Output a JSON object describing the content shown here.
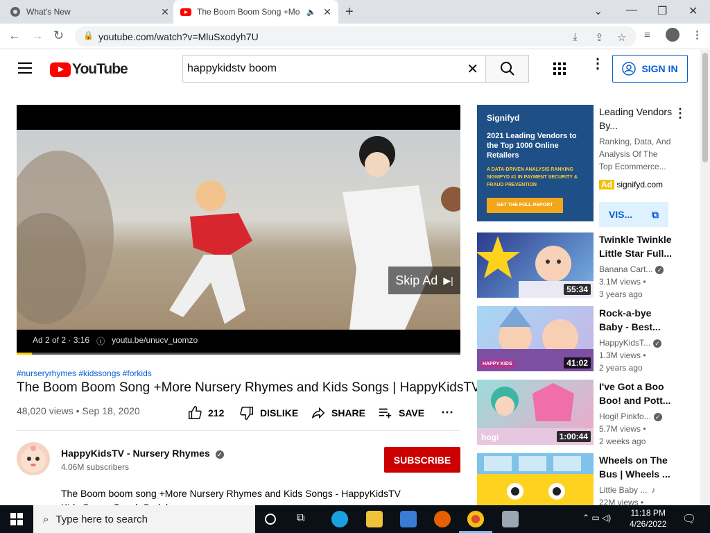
{
  "browser": {
    "tabs": [
      {
        "title": "What's New"
      },
      {
        "title": "The Boom Boom Song +Mo"
      }
    ],
    "url": "youtube.com/watch?v=MluSxodyh7U"
  },
  "header": {
    "logo_text": "YouTube",
    "search_value": "happykidstv boom",
    "signin_label": "SIGN IN"
  },
  "player": {
    "skip_label": "Skip Ad",
    "ad_counter": "Ad 2 of 2 · 3:16",
    "ad_link": "youtu.be/unucv_uomzo",
    "ad_progress_pct": 3.4
  },
  "video": {
    "tags": "#nurseryrhymes #kidssongs #forkids",
    "title": "The Boom Boom Song +More Nursery Rhymes and Kids Songs | HappyKidsTV",
    "stats": "48,020 views • Sep 18, 2020",
    "likes": "212",
    "dislike_label": "DISLIKE",
    "share_label": "SHARE",
    "save_label": "SAVE"
  },
  "channel": {
    "name": "HappyKidsTV - Nursery Rhymes",
    "subscribers": "4.06M subscribers",
    "subscribe_label": "SUBSCRIBE",
    "description_line1": "The Boom boom song +More Nursery Rhymes and Kids Songs - HappyKidsTV",
    "description_line2": "Kids Songs Çocuk Şarkıları"
  },
  "sidebar": {
    "ad": {
      "title": "Leading Vendors By...",
      "desc": "Ranking, Data, And Analysis Of The Top Ecommerce...",
      "badge": "Ad",
      "domain": "signifyd.com",
      "visit_label": "VIS...",
      "thumb_brand": "Signifyd",
      "thumb_headline": "2021 Leading Vendors to the Top 1000 Online Retailers",
      "thumb_sub": "A DATA-DRIVEN ANALYSIS RANKING SIGNIFYD #1 IN PAYMENT SECURITY & FRAUD PREVENTION",
      "thumb_cta": "GET THE FULL REPORT"
    },
    "videos": [
      {
        "title": "Twinkle Twinkle Little Star Full...",
        "channel": "Banana Cart...",
        "views": "3.1M views •",
        "age": "3 years ago",
        "duration": "55:34"
      },
      {
        "title": "Rock-a-bye Baby - Best...",
        "channel": "HappyKidsT...",
        "views": "1.3M views •",
        "age": "2 years ago",
        "duration": "41:02",
        "thumb_badge": "HAPPY KIDS"
      },
      {
        "title": "I've Got a Boo Boo! and Pott...",
        "channel": "Hogi! Pinkfo...",
        "views": "5.7M views •",
        "age": "2 weeks ago",
        "duration": "1:00:44",
        "thumb_badge": "hogi"
      },
      {
        "title": "Wheels on The Bus | Wheels ...",
        "channel": "Little Baby ...",
        "views": "22M views •",
        "age": "",
        "duration": ""
      }
    ]
  },
  "taskbar": {
    "search_placeholder": "Type here to search",
    "time": "11:18 PM",
    "date": "4/26/2022"
  }
}
